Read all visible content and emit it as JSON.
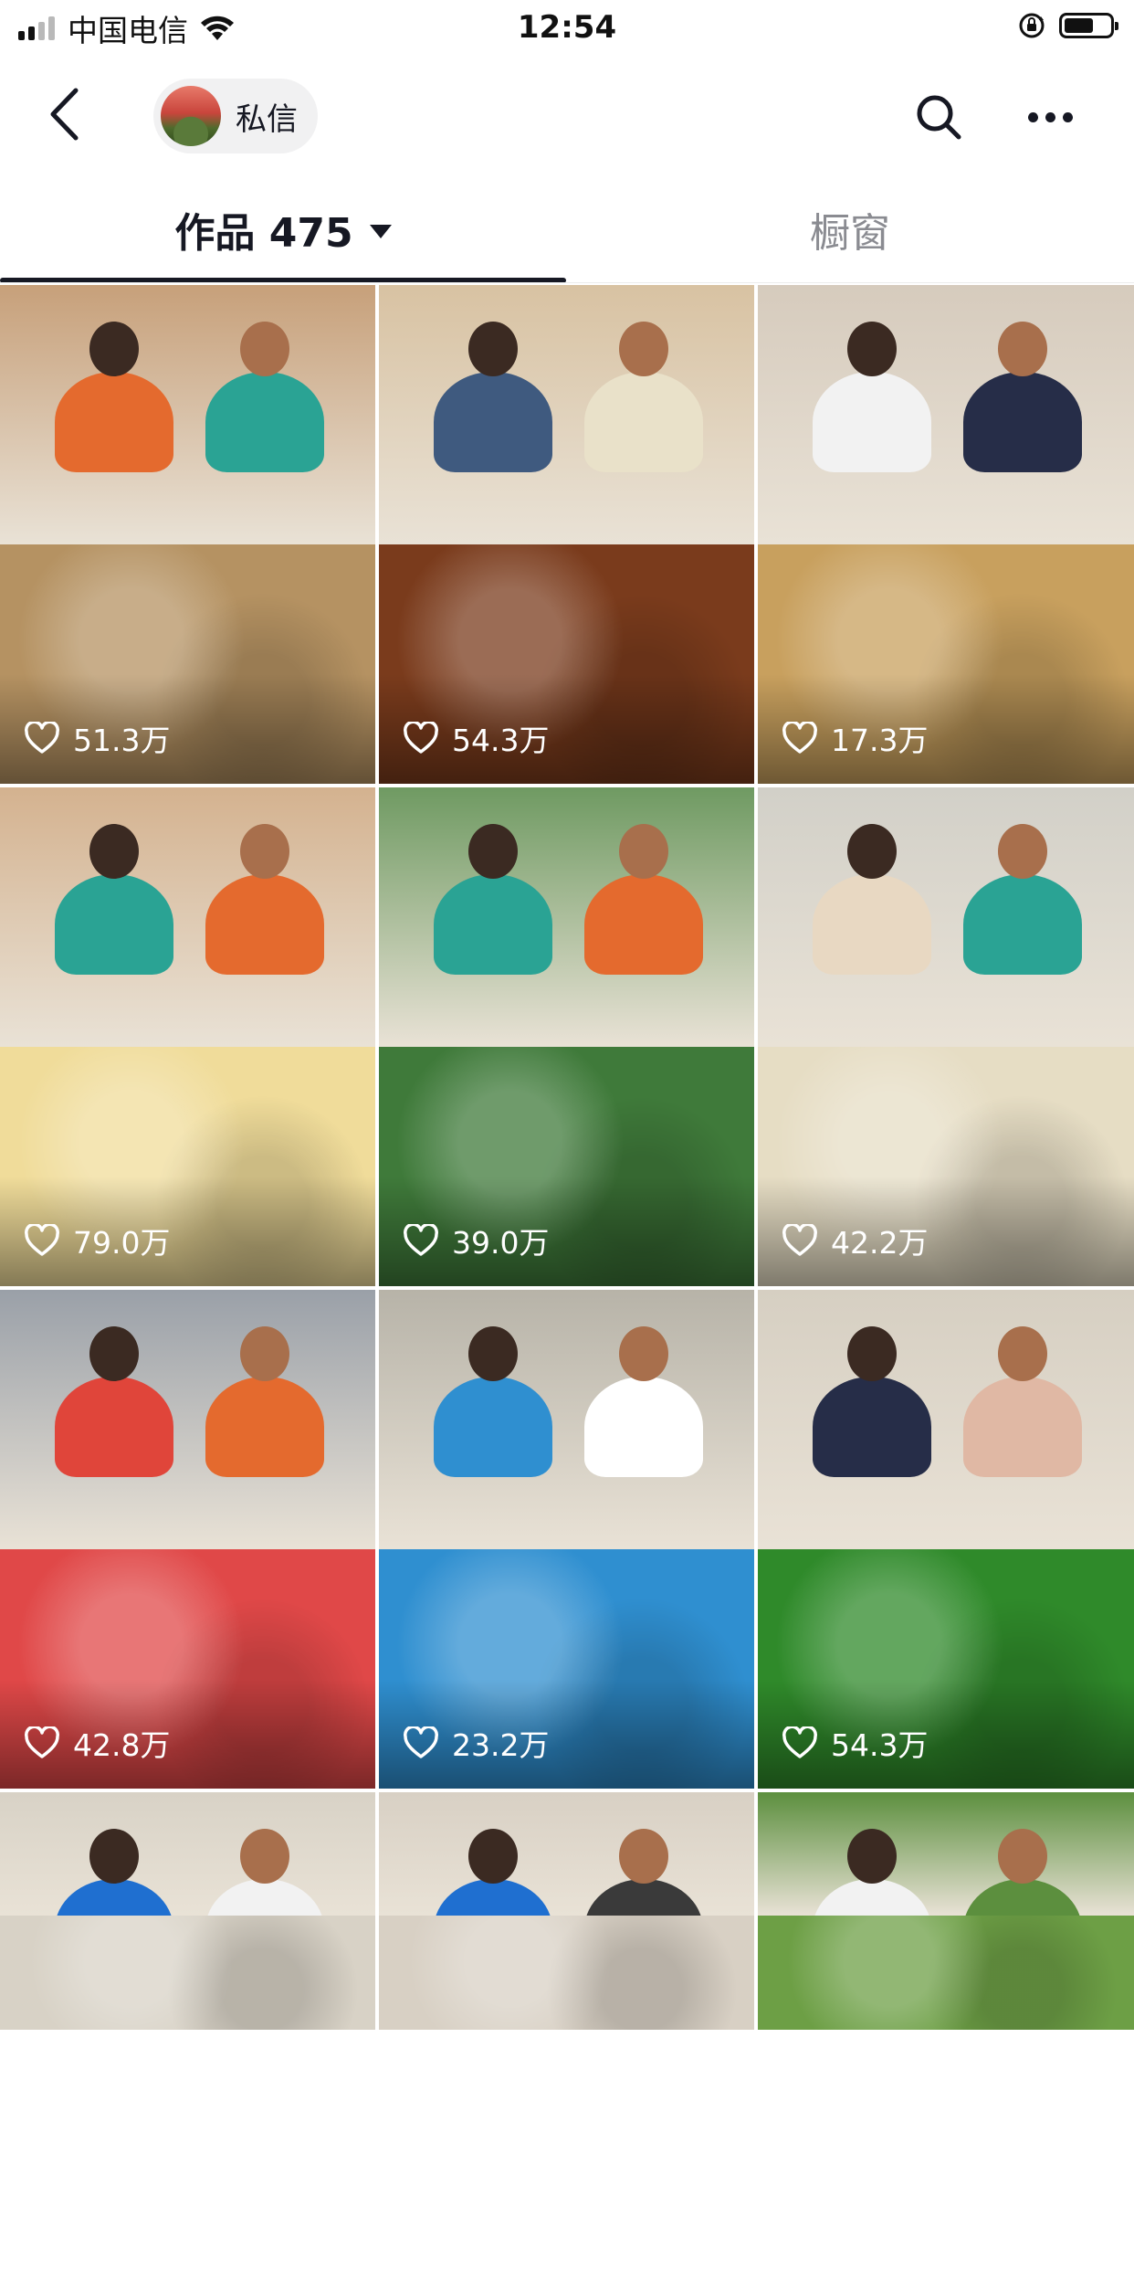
{
  "status_bar": {
    "carrier": "中国电信",
    "time": "12:54"
  },
  "nav": {
    "dm_label": "私信"
  },
  "tabs": {
    "works_label": "作品 475",
    "shop_label": "橱窗"
  },
  "videos": [
    {
      "likes": "51.3万",
      "top": "#c7a07a",
      "bottom": "#b59262",
      "person_a": "#e46a2e",
      "person_b": "#2aa394"
    },
    {
      "likes": "54.3万",
      "top": "#d8c2a2",
      "bottom": "#7a3b1c",
      "person_a": "#3f5a7f",
      "person_b": "#e9e1c9"
    },
    {
      "likes": "17.3万",
      "top": "#d6cbbd",
      "bottom": "#c8a05e",
      "person_a": "#f2f2f2",
      "person_b": "#262d48"
    },
    {
      "likes": "79.0万",
      "top": "#d4b28f",
      "bottom": "#f0dc9a",
      "person_a": "#2aa394",
      "person_b": "#e46a2e"
    },
    {
      "likes": "39.0万",
      "top": "#6f9a62",
      "bottom": "#3f7a3a",
      "person_a": "#2aa394",
      "person_b": "#e46a2e"
    },
    {
      "likes": "42.2万",
      "top": "#d2d0c8",
      "bottom": "#e6ddc4",
      "person_a": "#e8d8c2",
      "person_b": "#2aa394"
    },
    {
      "likes": "42.8万",
      "top": "#9aa0a8",
      "bottom": "#e04848",
      "person_a": "#e0453a",
      "person_b": "#e46a2e"
    },
    {
      "likes": "23.2万",
      "top": "#b7b3a8",
      "bottom": "#2f8fd0",
      "person_a": "#2f8fd0",
      "person_b": "#ffffff"
    },
    {
      "likes": "54.3万",
      "top": "#d6cfc2",
      "bottom": "#2f8a2a",
      "person_a": "#262d48",
      "person_b": "#e0b8a4"
    },
    {
      "likes": "",
      "top": "#d8d2c6",
      "bottom": "#d8d2c6",
      "person_a": "#1f6fd0",
      "person_b": "#f2f2f2"
    },
    {
      "likes": "",
      "top": "#d8d0c4",
      "bottom": "#d8d0c4",
      "person_a": "#1f6fd0",
      "person_b": "#3a3a3a"
    },
    {
      "likes": "",
      "top": "#5c8f3e",
      "bottom": "#6d9f45",
      "person_a": "#f2f2f2",
      "person_b": "#5c8f3e"
    }
  ]
}
